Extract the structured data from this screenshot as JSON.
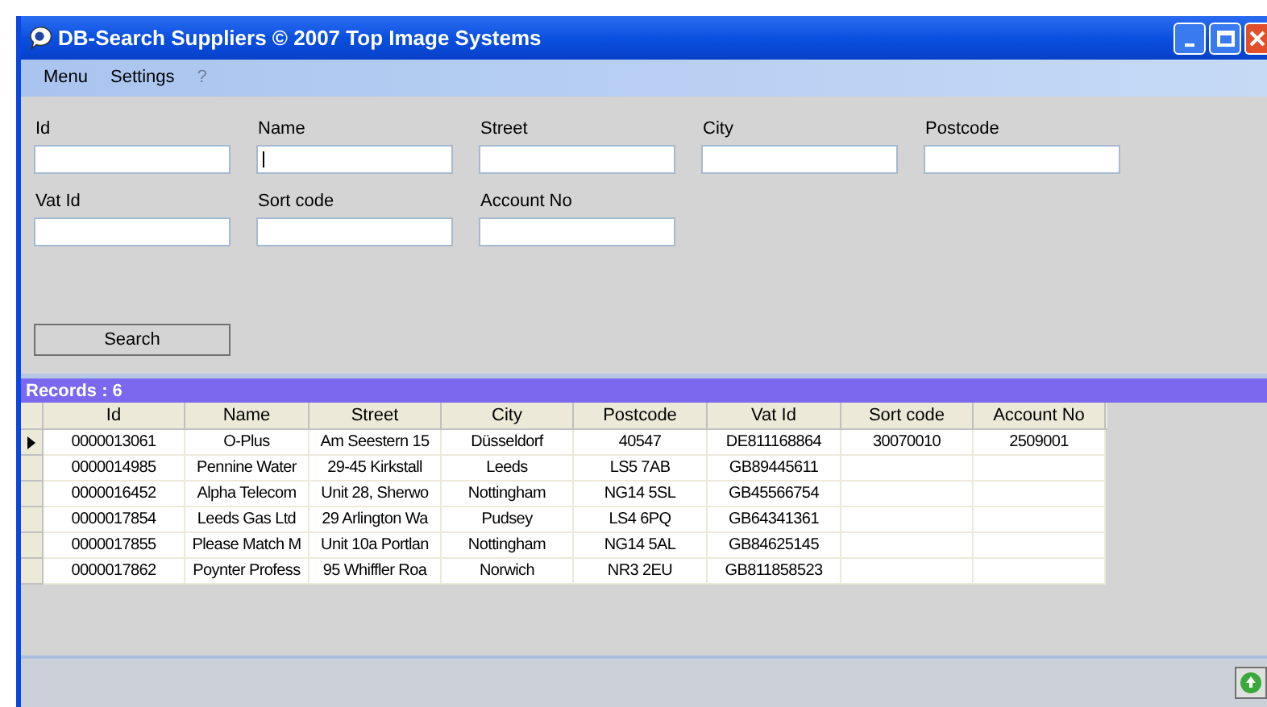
{
  "window": {
    "title": "DB-Search Suppliers © 2007 Top Image Systems"
  },
  "menu": [
    "Menu",
    "Settings",
    "?"
  ],
  "fields": [
    {
      "label": "Id"
    },
    {
      "label": "Name",
      "focused": true
    },
    {
      "label": "Street"
    },
    {
      "label": "City"
    },
    {
      "label": "Postcode"
    },
    {
      "label": "Vat Id"
    },
    {
      "label": "Sort code"
    },
    {
      "label": "Account No"
    }
  ],
  "search_button": "Search",
  "records_label": "Records : 6",
  "table": {
    "columns": [
      "Id",
      "Name",
      "Street",
      "City",
      "Postcode",
      "Vat Id",
      "Sort code",
      "Account No"
    ],
    "rows": [
      {
        "selected": true,
        "cells": [
          "0000013061",
          "O-Plus",
          "Am Seestern 15",
          "Düsseldorf",
          "40547",
          "DE811168864",
          "30070010",
          "2509001"
        ]
      },
      {
        "selected": false,
        "cells": [
          "0000014985",
          "Pennine Water",
          "29-45 Kirkstall",
          "Leeds",
          "LS5 7AB",
          "GB89445611",
          "",
          ""
        ]
      },
      {
        "selected": false,
        "cells": [
          "0000016452",
          "Alpha Telecom",
          "Unit 28, Sherwo",
          "Nottingham",
          "NG14 5SL",
          "GB45566754",
          "",
          ""
        ]
      },
      {
        "selected": false,
        "cells": [
          "0000017854",
          "Leeds Gas Ltd",
          "29 Arlington Wa",
          "Pudsey",
          "LS4 6PQ",
          "GB64341361",
          "",
          ""
        ]
      },
      {
        "selected": false,
        "cells": [
          "0000017855",
          "Please Match M",
          "Unit 10a Portlan",
          "Nottingham",
          "NG14 5AL",
          "GB84625145",
          "",
          ""
        ]
      },
      {
        "selected": false,
        "cells": [
          "0000017862",
          "Poynter Profess",
          "95 Whiffler Roa",
          "Norwich",
          "NR3 2EU",
          "GB811858523",
          "",
          ""
        ]
      }
    ]
  }
}
